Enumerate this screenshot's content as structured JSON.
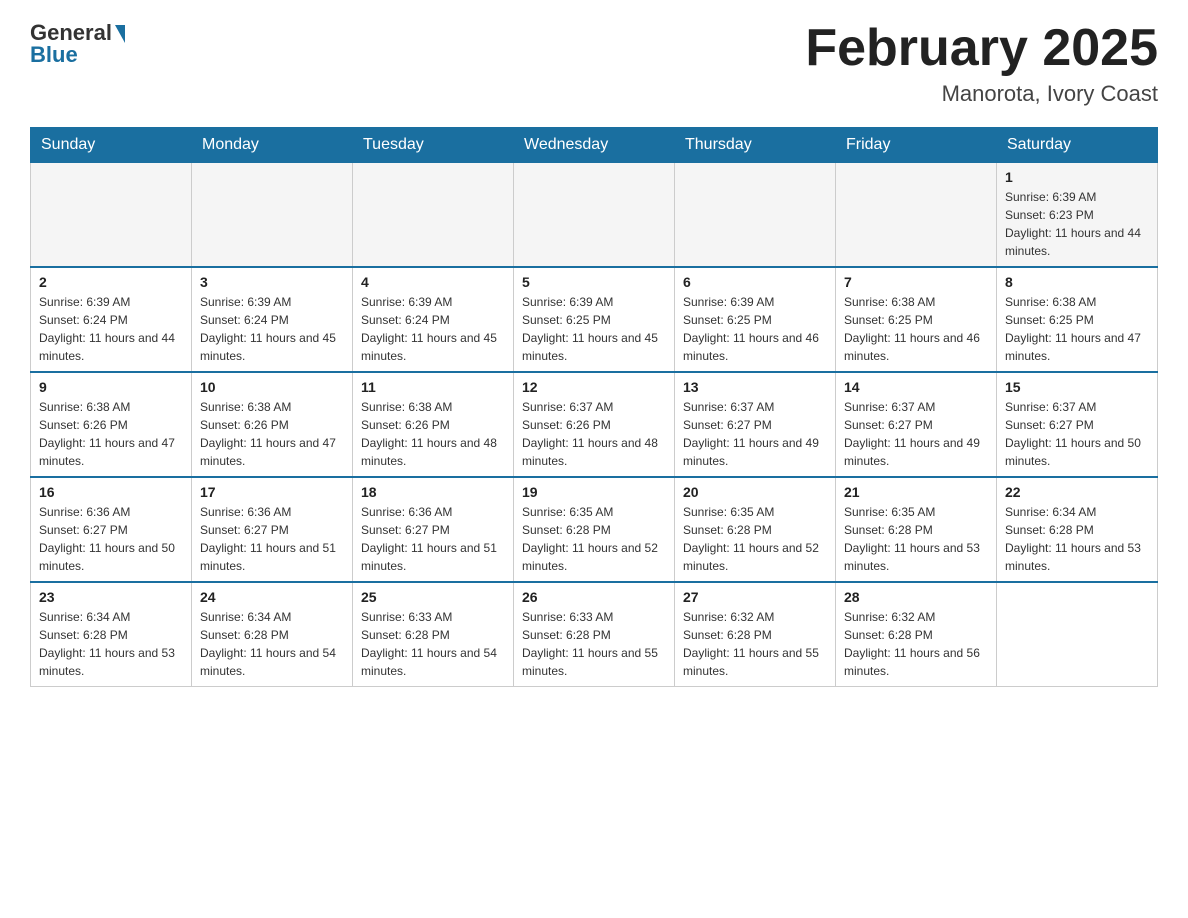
{
  "header": {
    "logo_general": "General",
    "logo_blue": "Blue",
    "month_title": "February 2025",
    "location": "Manorota, Ivory Coast"
  },
  "days_of_week": [
    "Sunday",
    "Monday",
    "Tuesday",
    "Wednesday",
    "Thursday",
    "Friday",
    "Saturday"
  ],
  "weeks": [
    {
      "days": [
        {
          "number": "",
          "info": ""
        },
        {
          "number": "",
          "info": ""
        },
        {
          "number": "",
          "info": ""
        },
        {
          "number": "",
          "info": ""
        },
        {
          "number": "",
          "info": ""
        },
        {
          "number": "",
          "info": ""
        },
        {
          "number": "1",
          "info": "Sunrise: 6:39 AM\nSunset: 6:23 PM\nDaylight: 11 hours and 44 minutes."
        }
      ]
    },
    {
      "days": [
        {
          "number": "2",
          "info": "Sunrise: 6:39 AM\nSunset: 6:24 PM\nDaylight: 11 hours and 44 minutes."
        },
        {
          "number": "3",
          "info": "Sunrise: 6:39 AM\nSunset: 6:24 PM\nDaylight: 11 hours and 45 minutes."
        },
        {
          "number": "4",
          "info": "Sunrise: 6:39 AM\nSunset: 6:24 PM\nDaylight: 11 hours and 45 minutes."
        },
        {
          "number": "5",
          "info": "Sunrise: 6:39 AM\nSunset: 6:25 PM\nDaylight: 11 hours and 45 minutes."
        },
        {
          "number": "6",
          "info": "Sunrise: 6:39 AM\nSunset: 6:25 PM\nDaylight: 11 hours and 46 minutes."
        },
        {
          "number": "7",
          "info": "Sunrise: 6:38 AM\nSunset: 6:25 PM\nDaylight: 11 hours and 46 minutes."
        },
        {
          "number": "8",
          "info": "Sunrise: 6:38 AM\nSunset: 6:25 PM\nDaylight: 11 hours and 47 minutes."
        }
      ]
    },
    {
      "days": [
        {
          "number": "9",
          "info": "Sunrise: 6:38 AM\nSunset: 6:26 PM\nDaylight: 11 hours and 47 minutes."
        },
        {
          "number": "10",
          "info": "Sunrise: 6:38 AM\nSunset: 6:26 PM\nDaylight: 11 hours and 47 minutes."
        },
        {
          "number": "11",
          "info": "Sunrise: 6:38 AM\nSunset: 6:26 PM\nDaylight: 11 hours and 48 minutes."
        },
        {
          "number": "12",
          "info": "Sunrise: 6:37 AM\nSunset: 6:26 PM\nDaylight: 11 hours and 48 minutes."
        },
        {
          "number": "13",
          "info": "Sunrise: 6:37 AM\nSunset: 6:27 PM\nDaylight: 11 hours and 49 minutes."
        },
        {
          "number": "14",
          "info": "Sunrise: 6:37 AM\nSunset: 6:27 PM\nDaylight: 11 hours and 49 minutes."
        },
        {
          "number": "15",
          "info": "Sunrise: 6:37 AM\nSunset: 6:27 PM\nDaylight: 11 hours and 50 minutes."
        }
      ]
    },
    {
      "days": [
        {
          "number": "16",
          "info": "Sunrise: 6:36 AM\nSunset: 6:27 PM\nDaylight: 11 hours and 50 minutes."
        },
        {
          "number": "17",
          "info": "Sunrise: 6:36 AM\nSunset: 6:27 PM\nDaylight: 11 hours and 51 minutes."
        },
        {
          "number": "18",
          "info": "Sunrise: 6:36 AM\nSunset: 6:27 PM\nDaylight: 11 hours and 51 minutes."
        },
        {
          "number": "19",
          "info": "Sunrise: 6:35 AM\nSunset: 6:28 PM\nDaylight: 11 hours and 52 minutes."
        },
        {
          "number": "20",
          "info": "Sunrise: 6:35 AM\nSunset: 6:28 PM\nDaylight: 11 hours and 52 minutes."
        },
        {
          "number": "21",
          "info": "Sunrise: 6:35 AM\nSunset: 6:28 PM\nDaylight: 11 hours and 53 minutes."
        },
        {
          "number": "22",
          "info": "Sunrise: 6:34 AM\nSunset: 6:28 PM\nDaylight: 11 hours and 53 minutes."
        }
      ]
    },
    {
      "days": [
        {
          "number": "23",
          "info": "Sunrise: 6:34 AM\nSunset: 6:28 PM\nDaylight: 11 hours and 53 minutes."
        },
        {
          "number": "24",
          "info": "Sunrise: 6:34 AM\nSunset: 6:28 PM\nDaylight: 11 hours and 54 minutes."
        },
        {
          "number": "25",
          "info": "Sunrise: 6:33 AM\nSunset: 6:28 PM\nDaylight: 11 hours and 54 minutes."
        },
        {
          "number": "26",
          "info": "Sunrise: 6:33 AM\nSunset: 6:28 PM\nDaylight: 11 hours and 55 minutes."
        },
        {
          "number": "27",
          "info": "Sunrise: 6:32 AM\nSunset: 6:28 PM\nDaylight: 11 hours and 55 minutes."
        },
        {
          "number": "28",
          "info": "Sunrise: 6:32 AM\nSunset: 6:28 PM\nDaylight: 11 hours and 56 minutes."
        },
        {
          "number": "",
          "info": ""
        }
      ]
    }
  ]
}
